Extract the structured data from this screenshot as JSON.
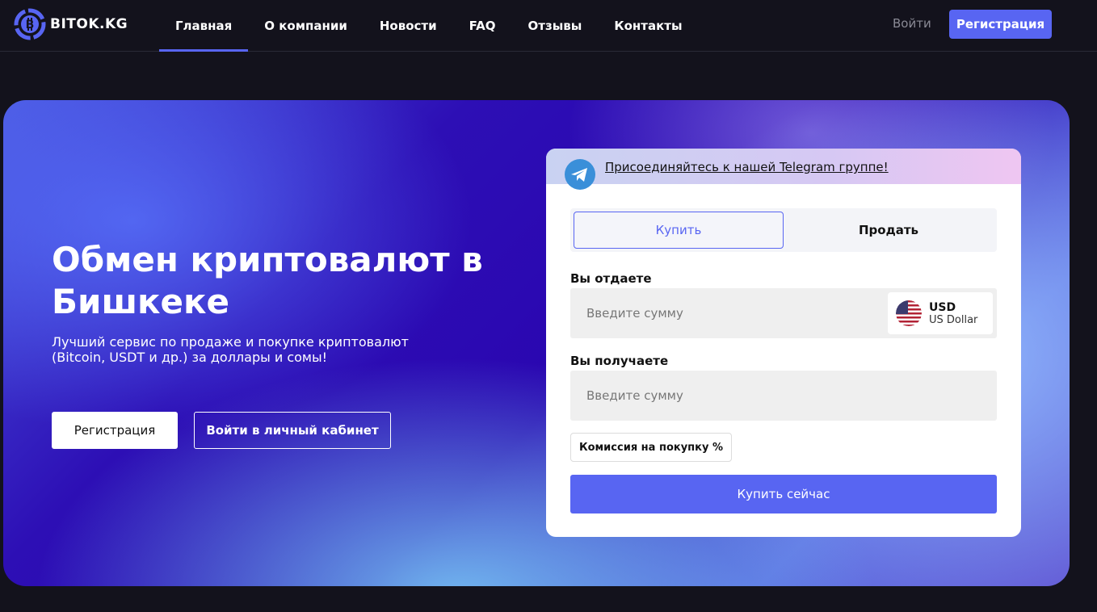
{
  "header": {
    "logo_text": "BITOK.KG",
    "nav": [
      {
        "label": "Главная",
        "active": true
      },
      {
        "label": "О компании"
      },
      {
        "label": "Новости"
      },
      {
        "label": "FAQ"
      },
      {
        "label": "Отзывы"
      },
      {
        "label": "Контакты"
      }
    ],
    "login_label": "Войти",
    "register_label": "Регистрация"
  },
  "hero": {
    "title": "Обмен криптовалют в Бишкеке",
    "subtitle": "Лучший сервис по продаже и покупке криптовалют (Bitcoin, USDT и др.) за доллары и сомы!",
    "register_button": "Регистрация",
    "login_button": "Войти в личный кабинет"
  },
  "exchange": {
    "telegram_link": "Присоединяйтесь к нашей Telegram группе!",
    "tabs": {
      "buy": "Купить",
      "sell": "Продать",
      "selected": "buy"
    },
    "give_label": "Вы отдаете",
    "give_placeholder": "Введите сумму",
    "currency": {
      "code": "USD",
      "name": "US Dollar",
      "icon": "us-flag-icon"
    },
    "receive_label": "Вы получаете",
    "receive_placeholder": "Введите сумму",
    "commission_label": "Комиссия на покупку %",
    "submit_label": "Купить сейчас"
  },
  "colors": {
    "accent": "#5865f2",
    "background": "#13121c"
  }
}
